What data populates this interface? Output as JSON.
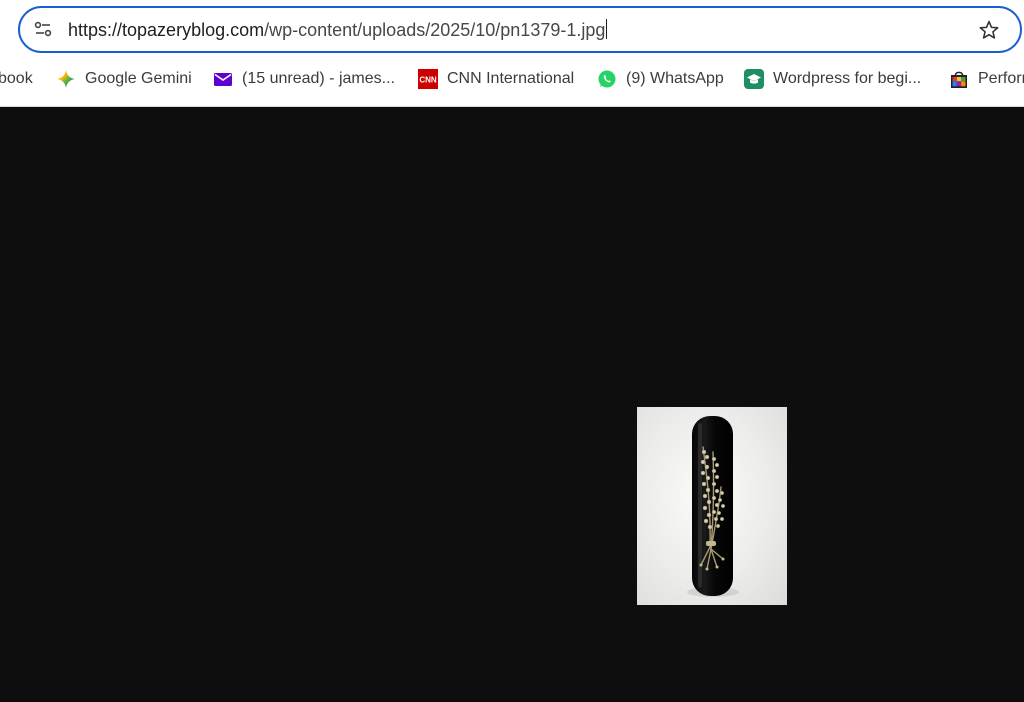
{
  "browser": {
    "url": {
      "host_part": "https://topazeryblog.com",
      "path_part": "/wp-content/uploads/2025/10/pn1379-1.jpg"
    },
    "icons": {
      "site_info": "tune-icon",
      "bookmark_star": "star-icon"
    },
    "accent_color": "#1a5fd1"
  },
  "bookmarks": [
    {
      "label": "book",
      "icon": "none"
    },
    {
      "label": "Google Gemini",
      "icon": "gemini-icon"
    },
    {
      "label": "(15 unread) - james...",
      "icon": "mail-icon"
    },
    {
      "label": "CNN International",
      "icon": "cnn-icon"
    },
    {
      "label": "(9) WhatsApp",
      "icon": "whatsapp-icon"
    },
    {
      "label": "Wordpress for begi...",
      "icon": "graduation-cap-icon"
    },
    {
      "label": "Perforn",
      "icon": "shopping-bag-icon"
    }
  ],
  "viewer": {
    "background": "#0e0e0e",
    "image_subject": "black bar brooch with seed pearl wheat sheaf"
  }
}
